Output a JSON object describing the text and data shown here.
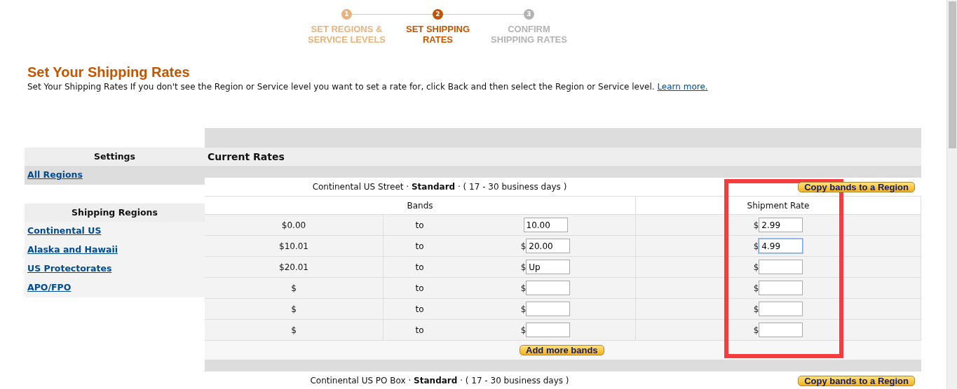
{
  "steps": [
    {
      "number": "1",
      "label": "SET REGIONS & SERVICE LEVELS",
      "selected": false,
      "completed": true
    },
    {
      "number": "2",
      "label": "SET SHIPPING RATES",
      "selected": true,
      "completed": false
    },
    {
      "number": "3",
      "label": "CONFIRM SHIPPING RATES",
      "selected": false,
      "completed": false
    }
  ],
  "page_title": "Set Your Shipping Rates",
  "intro": {
    "text": "Set Your Shipping Rates If you don't see the Region or Service level you want to set a rate for, click Back and then select the Region or Service level.",
    "link": "Learn more."
  },
  "sidebar": [
    {
      "heading": "Settings",
      "items": [
        {
          "label": "All Regions",
          "selected": true
        }
      ]
    },
    {
      "heading": "Shipping Regions",
      "items": [
        {
          "label": "Continental US",
          "selected": false
        },
        {
          "label": "Alaska and Hawaii",
          "selected": false
        },
        {
          "label": "US Protectorates",
          "selected": false
        },
        {
          "label": "APO/FPO",
          "selected": false
        }
      ]
    }
  ],
  "section_title": "Current Rates",
  "rate_groups": [
    {
      "heading": "Continental US Street · **Standard** · ( 17 - 30 business days )",
      "copy_button": "Copy bands to a Region",
      "columns": [
        "Bands",
        "Shipment Rate"
      ],
      "bands": [
        {
          "from": "$0.00",
          "to_label": "to",
          "to_value": "10.00",
          "rate_prefix": "$",
          "rate": "2.99",
          "focused": false
        },
        {
          "from": "$10.01",
          "to_label": "to",
          "to_prefix": "$",
          "to_value": "20.00",
          "rate_prefix": "$",
          "rate": "4.99",
          "focused": true
        },
        {
          "from": "$20.01",
          "to_label": "to",
          "to_prefix": "$",
          "to_value": "Up",
          "rate_prefix": "$",
          "focused": false
        },
        {
          "from": "$",
          "to_label": "to",
          "to_prefix": "$",
          "rate_prefix": "$",
          "focused": false
        },
        {
          "from": "$",
          "to_label": "to",
          "to_prefix": "$",
          "rate_prefix": "$",
          "focused": false
        },
        {
          "from": "$",
          "to_label": "to",
          "to_prefix": "$",
          "rate_prefix": "$",
          "focused": false
        }
      ],
      "add_button": "Add more bands",
      "highlighted": true
    },
    {
      "heading": "Continental US PO Box · **Standard** · ( 17 - 30 business days )",
      "copy_button": "Copy bands to a Region",
      "highlighted": false
    }
  ]
}
